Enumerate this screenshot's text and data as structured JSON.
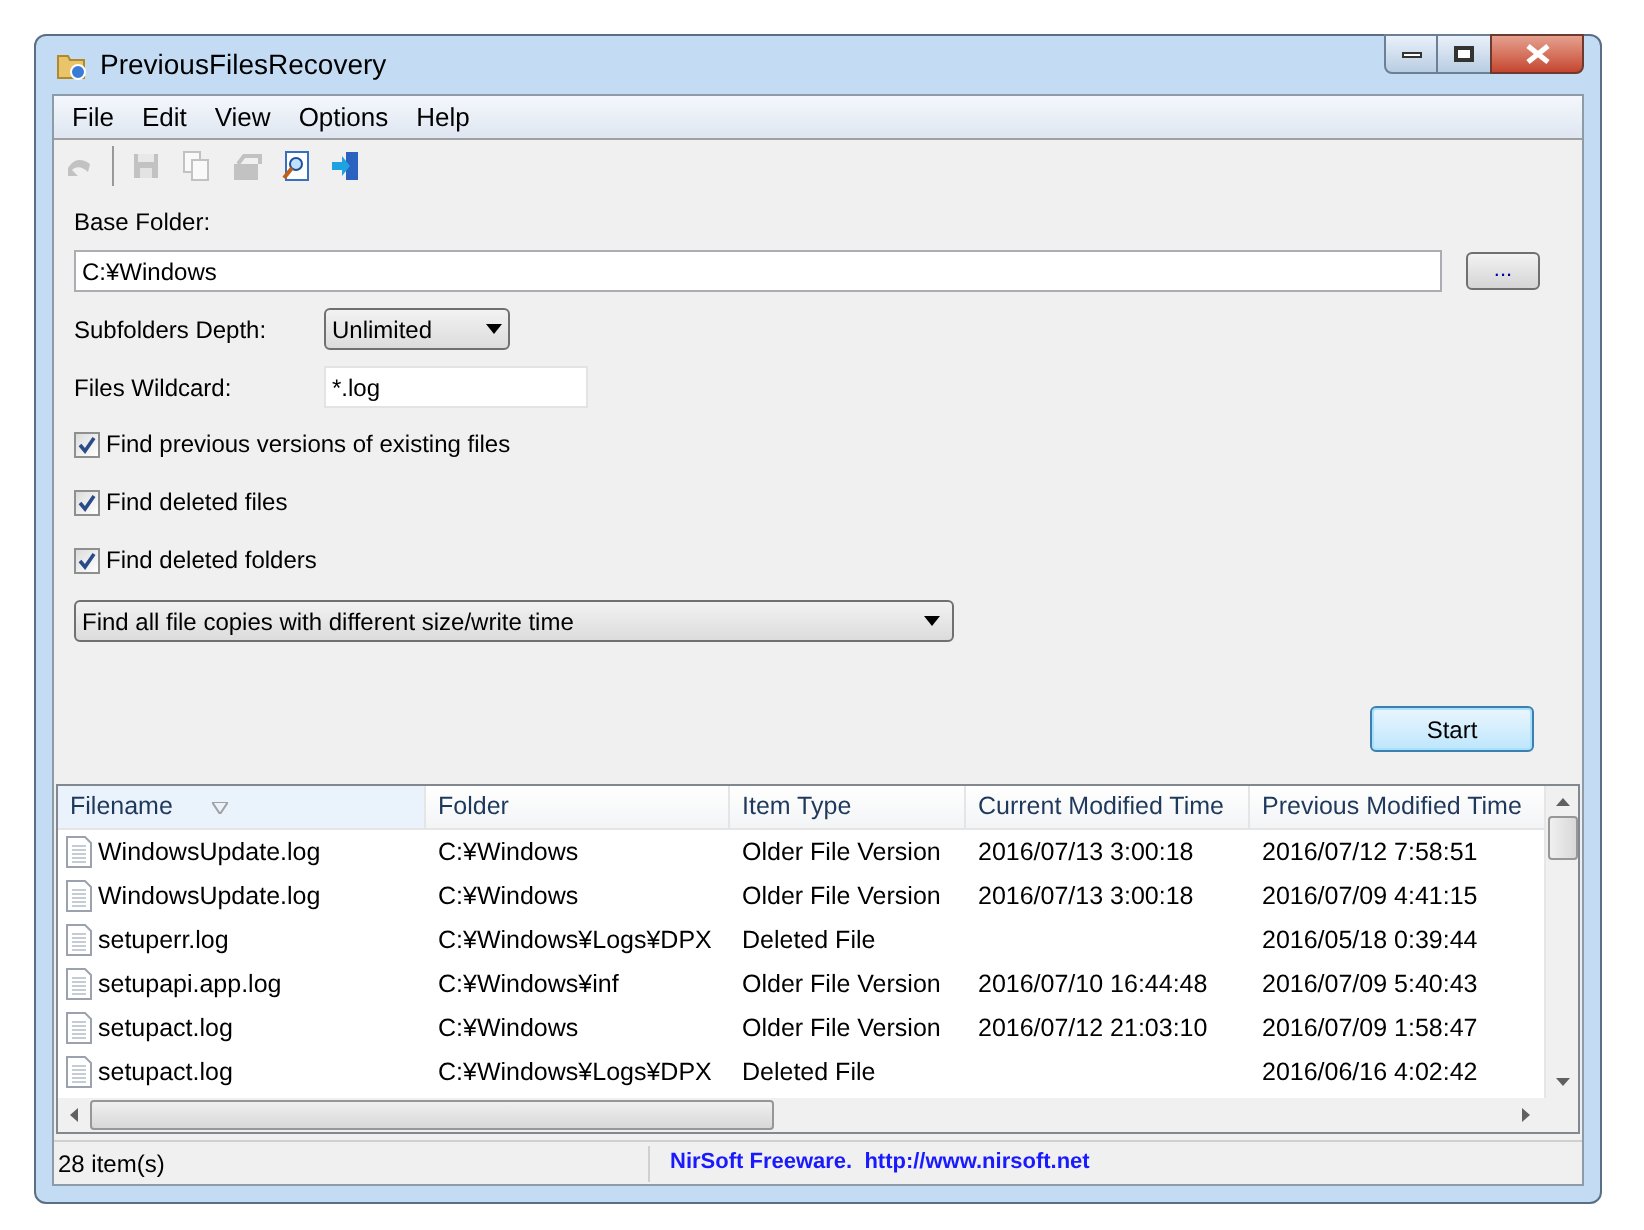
{
  "window": {
    "title": "PreviousFilesRecovery"
  },
  "menu": [
    "File",
    "Edit",
    "View",
    "Options",
    "Help"
  ],
  "toolbar": [
    {
      "kind": "back",
      "disabled": true
    },
    {
      "kind": "separator"
    },
    {
      "kind": "save",
      "disabled": true
    },
    {
      "kind": "copy",
      "disabled": true
    },
    {
      "kind": "properties",
      "disabled": true
    },
    {
      "kind": "find",
      "disabled": false
    },
    {
      "kind": "exit",
      "disabled": false
    }
  ],
  "form": {
    "base_folder": {
      "label": "Base Folder:",
      "value": "C:¥Windows",
      "browse": "..."
    },
    "depth": {
      "label": "Subfolders Depth:",
      "value": "Unlimited"
    },
    "wildcard": {
      "label": "Files Wildcard:",
      "value": "*.log"
    },
    "options": [
      {
        "label": "Find previous versions of existing files",
        "checked": true
      },
      {
        "label": "Find deleted files",
        "checked": true
      },
      {
        "label": "Find deleted folders",
        "checked": true
      }
    ],
    "mode": {
      "value": "Find all file copies with different size/write time"
    },
    "start": "Start"
  },
  "table": {
    "columns": [
      {
        "label": "Filename",
        "sorted": true
      },
      {
        "label": "Folder",
        "sorted": false
      },
      {
        "label": "Item Type",
        "sorted": false
      },
      {
        "label": "Current Modified Time",
        "sorted": false
      },
      {
        "label": "Previous Modified Time",
        "sorted": false
      }
    ],
    "rows": [
      [
        "WindowsUpdate.log",
        "C:¥Windows",
        "Older File Version",
        "2016/07/13 3:00:18",
        "2016/07/12 7:58:51"
      ],
      [
        "WindowsUpdate.log",
        "C:¥Windows",
        "Older File Version",
        "2016/07/13 3:00:18",
        "2016/07/09 4:41:15"
      ],
      [
        "setuperr.log",
        "C:¥Windows¥Logs¥DPX",
        "Deleted File",
        "",
        "2016/05/18 0:39:44"
      ],
      [
        "setupapi.app.log",
        "C:¥Windows¥inf",
        "Older File Version",
        "2016/07/10 16:44:48",
        "2016/07/09 5:40:43"
      ],
      [
        "setupact.log",
        "C:¥Windows",
        "Older File Version",
        "2016/07/12 21:03:10",
        "2016/07/09 1:58:47"
      ],
      [
        "setupact.log",
        "C:¥Windows¥Logs¥DPX",
        "Deleted File",
        "",
        "2016/06/16 4:02:42"
      ]
    ]
  },
  "status_bar": {
    "count": "28 item(s)",
    "credit": "NirSoft Freeware.  http://www.nirsoft.net"
  }
}
